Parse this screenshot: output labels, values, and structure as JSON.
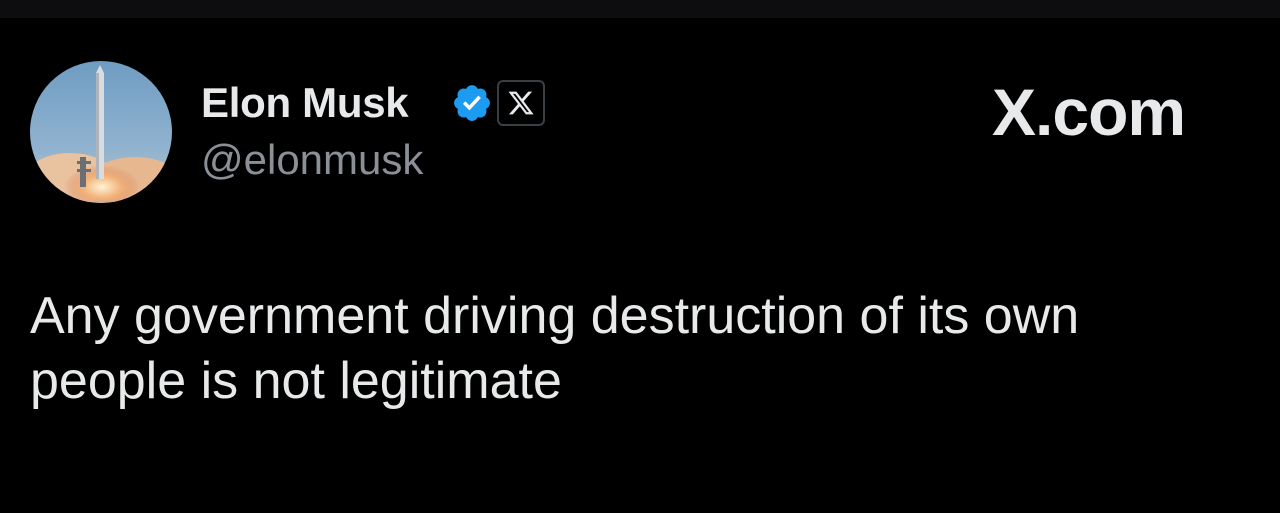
{
  "author": {
    "display_name": "Elon Musk",
    "handle": "@elonmusk",
    "verified": true,
    "affiliate_badge": "X"
  },
  "site": {
    "logo": "X.com"
  },
  "tweet": {
    "text": "Any government driving destruction of its own\npeople is not legitimate"
  },
  "icons": {
    "verified": "verified-checkmark-icon",
    "affiliate": "x-logo-icon",
    "avatar": "rocket-launch-avatar"
  },
  "colors": {
    "background": "#000000",
    "text_primary": "#e7e9ea",
    "text_secondary": "#8b9097",
    "verified_blue": "#1d9bf0"
  }
}
